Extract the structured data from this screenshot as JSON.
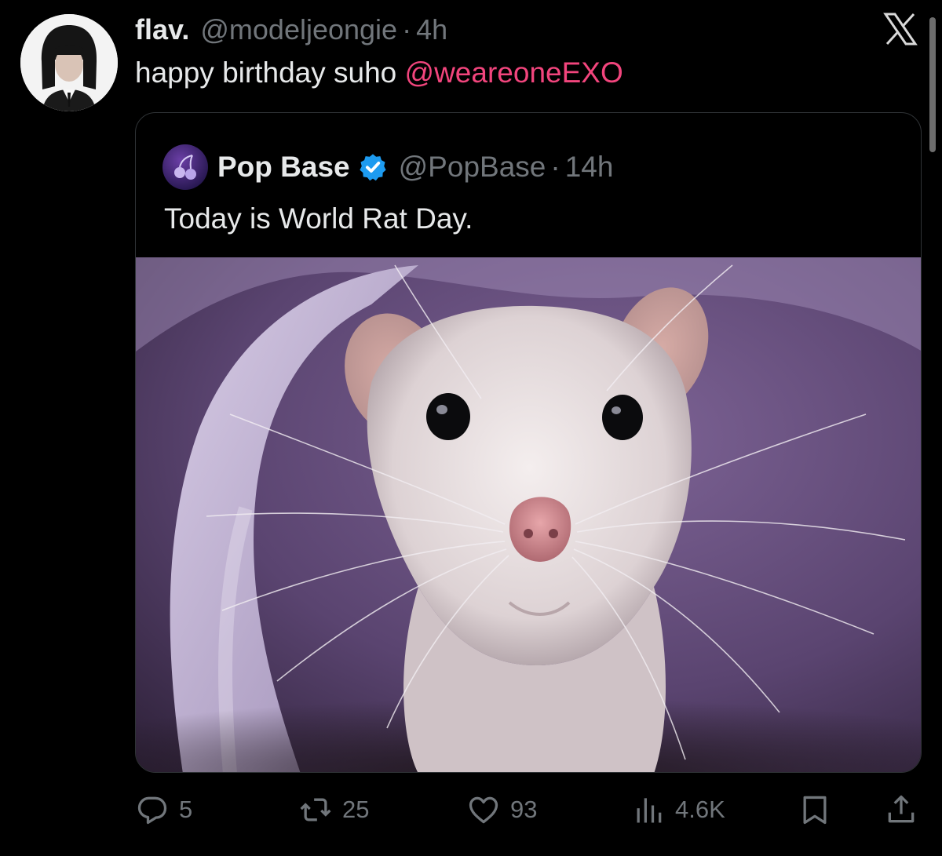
{
  "tweet": {
    "display_name": "flav.",
    "handle": "@modeljeongie",
    "separator": "·",
    "time": "4h",
    "text": "happy birthday suho",
    "mention": "@weareoneEXO"
  },
  "quoted_tweet": {
    "display_name": "Pop Base",
    "handle": "@PopBase",
    "separator": "·",
    "time": "14h",
    "text": "Today is World Rat Day.",
    "verified": true,
    "media_description_icon": "rat-photo"
  },
  "actions": {
    "replies": "5",
    "reposts": "25",
    "likes": "93",
    "views": "4.6K"
  },
  "colors": {
    "background": "#000000",
    "text": "#e7e9ea",
    "muted": "#71767b",
    "mention": "#f2457d",
    "verified": "#1d9bf0",
    "border": "#2f3336"
  },
  "icons": [
    "x-logo-icon",
    "verified-badge-icon",
    "reply-icon",
    "repost-icon",
    "like-icon",
    "views-icon",
    "bookmark-icon",
    "share-icon"
  ]
}
